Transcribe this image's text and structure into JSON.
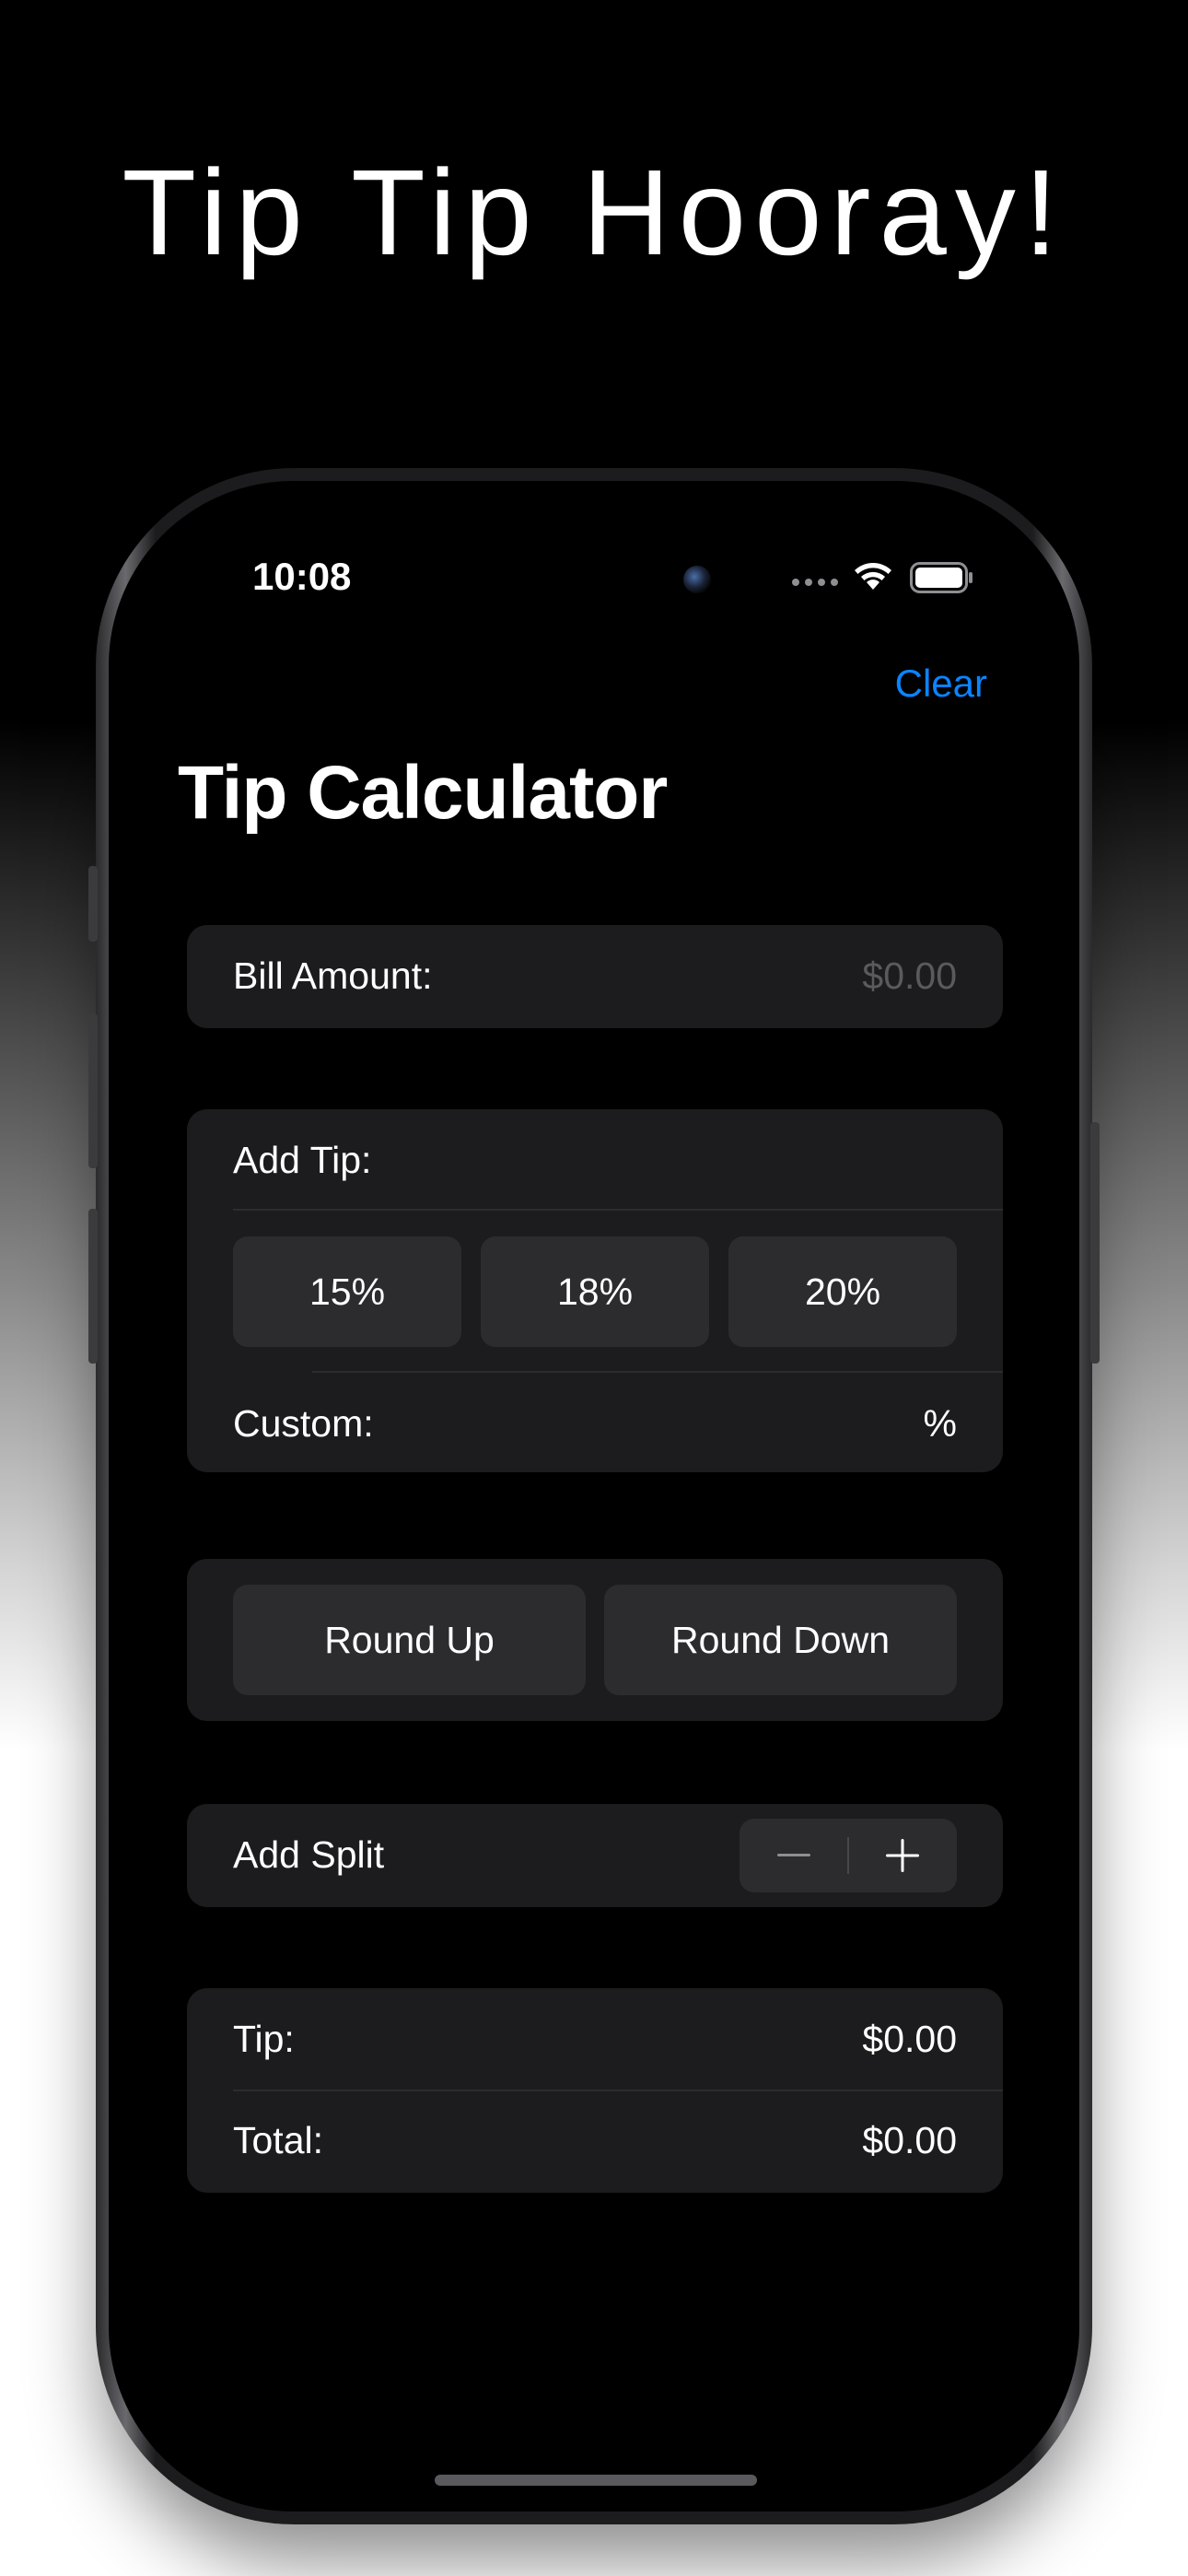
{
  "marketing": {
    "headline": "Tip Tip Hooray!"
  },
  "status_bar": {
    "time": "10:08",
    "icons": [
      "signal-dots-icon",
      "wifi-icon",
      "battery-icon"
    ]
  },
  "nav": {
    "clear_label": "Clear",
    "title": "Tip Calculator"
  },
  "bill": {
    "label": "Bill Amount:",
    "placeholder": "$0.00"
  },
  "tip": {
    "label": "Add Tip:",
    "options": [
      "15%",
      "18%",
      "20%"
    ],
    "custom_label": "Custom:",
    "custom_suffix": "%"
  },
  "rounding": {
    "round_up": "Round Up",
    "round_down": "Round Down"
  },
  "split": {
    "label": "Add Split",
    "minus_icon": "minus-icon",
    "plus_icon": "plus-icon"
  },
  "summary": {
    "tip_label": "Tip:",
    "tip_value": "$0.00",
    "total_label": "Total:",
    "total_value": "$0.00"
  },
  "colors": {
    "accent": "#0a84ff",
    "card_background": "#1c1c1e",
    "button_background": "#2c2c2e",
    "screen_background": "#000000"
  }
}
